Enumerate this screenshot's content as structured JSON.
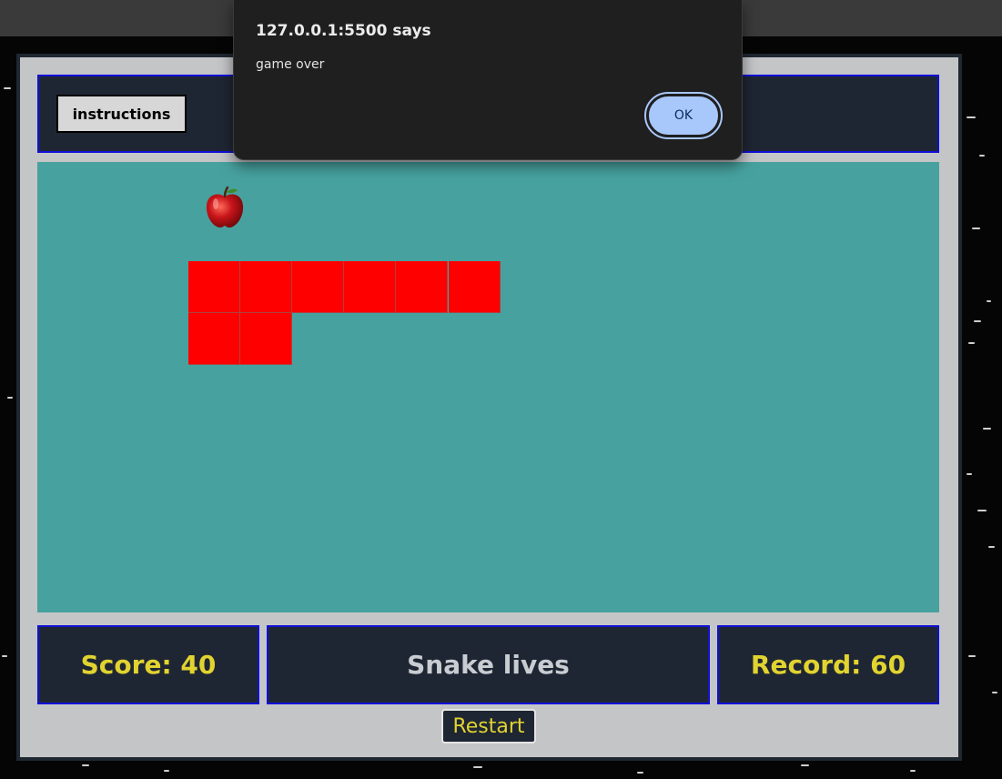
{
  "alert": {
    "title": "127.0.0.1:5500 says",
    "message": "game over",
    "ok_label": "OK",
    "ok_color": "#a8c7fa"
  },
  "header": {
    "instructions_label": "instructions"
  },
  "board": {
    "background_color": "#47a29f",
    "snake_color": "#ff0000",
    "apple_icon": "apple-icon"
  },
  "stats": {
    "score_label": "Score: 40",
    "status_label": "Snake lives",
    "record_label": "Record: 60"
  },
  "restart_label": "Restart",
  "colors": {
    "panel_bg": "#1f2633",
    "panel_border": "#1010d8",
    "accent_yellow": "#e1d330"
  }
}
